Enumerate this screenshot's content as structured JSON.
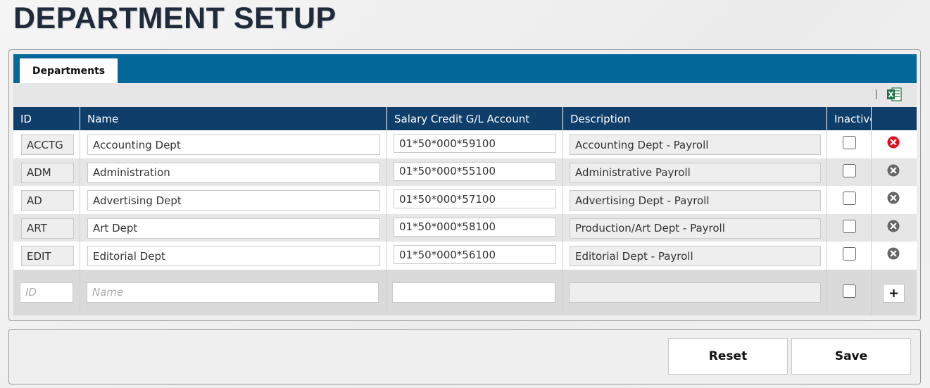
{
  "page": {
    "title": "DEPARTMENT SETUP"
  },
  "tabs": [
    {
      "label": "Departments",
      "active": true
    }
  ],
  "toolbar": {
    "export_icon": "excel-icon"
  },
  "columns": [
    "ID",
    "Name",
    "Salary Credit G/L Account",
    "Description",
    "Inactive"
  ],
  "rows": [
    {
      "id": "ACCTG",
      "name": "Accounting Dept",
      "gl_account": "01*50*000*59100",
      "description": "Accounting Dept - Payroll",
      "inactive": false,
      "delete_icon_color": "#e0101e"
    },
    {
      "id": "ADM",
      "name": "Administration",
      "gl_account": "01*50*000*55100",
      "description": "Administrative Payroll",
      "inactive": false,
      "delete_icon_color": "#666666"
    },
    {
      "id": "AD",
      "name": "Advertising Dept",
      "gl_account": "01*50*000*57100",
      "description": "Advertising Dept - Payroll",
      "inactive": false,
      "delete_icon_color": "#666666"
    },
    {
      "id": "ART",
      "name": "Art Dept",
      "gl_account": "01*50*000*58100",
      "description": "Production/Art Dept - Payroll",
      "inactive": false,
      "delete_icon_color": "#666666"
    },
    {
      "id": "EDIT",
      "name": "Editorial Dept",
      "gl_account": "01*50*000*56100",
      "description": "Editorial Dept - Payroll",
      "inactive": false,
      "delete_icon_color": "#666666"
    }
  ],
  "new_row": {
    "id_placeholder": "ID",
    "name_placeholder": "Name",
    "gl_account_value": "",
    "description_value": "",
    "add_label": "+"
  },
  "footer": {
    "reset_label": "Reset",
    "save_label": "Save"
  },
  "colors": {
    "tabbar": "#04679a",
    "header": "#0f3e6a",
    "title": "#1f2a3a",
    "delete_active": "#e0101e",
    "excel": "#1e7145"
  }
}
